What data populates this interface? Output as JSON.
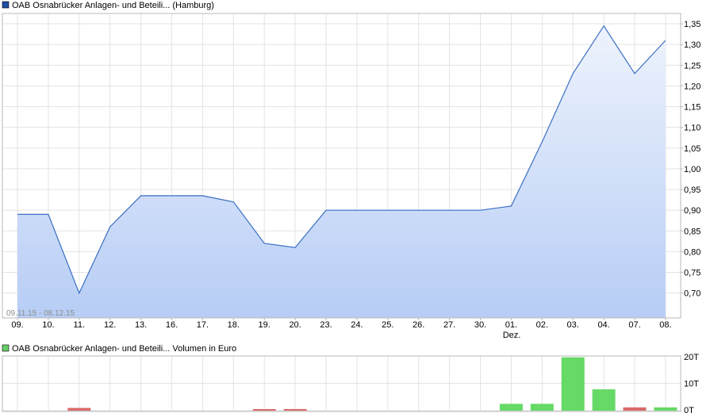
{
  "price_chart": {
    "legend_label": "OAB Osnabrücker Anlagen- und Beteili... (Hamburg)",
    "legend_color": "#1f4fa3",
    "date_range": "09.11.15 - 08.12.15",
    "month_label": "Dez.",
    "line_color": "#3a6fc2",
    "fill_top": "#eef3fd",
    "fill_bottom": "#b7cdf5"
  },
  "volume_chart": {
    "legend_label": "OAB Osnabrücker Anlagen- und Beteili... Volumen in Euro",
    "legend_color": "#66cc66",
    "up_color": "#66d966",
    "down_color": "#d96a6a"
  },
  "chart_data": [
    {
      "type": "line",
      "categories": [
        "09.",
        "10.",
        "11.",
        "12.",
        "13.",
        "16.",
        "17.",
        "18.",
        "19.",
        "20.",
        "23.",
        "24.",
        "25.",
        "26.",
        "27.",
        "30.",
        "01.",
        "02.",
        "03.",
        "04.",
        "07.",
        "08."
      ],
      "series": [
        {
          "name": "OAB Osnabrücker Anlagen- und Beteili... (Hamburg)",
          "values": [
            0.89,
            0.89,
            0.7,
            0.86,
            0.935,
            0.935,
            0.935,
            0.92,
            0.82,
            0.81,
            0.9,
            0.9,
            0.9,
            0.9,
            0.9,
            0.9,
            0.91,
            1.065,
            1.23,
            1.345,
            1.23,
            1.31
          ]
        }
      ],
      "yticks": [
        "1,35",
        "1,30",
        "1,25",
        "1,20",
        "1,15",
        "1,10",
        "1,05",
        "1,00",
        "0,95",
        "0,90",
        "0,85",
        "0,80",
        "0,75",
        "0,70"
      ],
      "ylim": [
        0.64,
        1.375
      ],
      "grid": true
    },
    {
      "type": "bar",
      "categories": [
        "09.",
        "10.",
        "11.",
        "12.",
        "13.",
        "16.",
        "17.",
        "18.",
        "19.",
        "20.",
        "23.",
        "24.",
        "25.",
        "26.",
        "27.",
        "30.",
        "01.",
        "02.",
        "03.",
        "04.",
        "07.",
        "08."
      ],
      "series": [
        {
          "name": "OAB Osnabrücker Anlagen- und Beteili... Volumen in Euro",
          "values": [
            0,
            0,
            1000,
            0,
            0,
            0,
            0,
            0,
            400,
            600,
            0,
            0,
            0,
            0,
            0,
            0,
            2500,
            2500,
            19500,
            7800,
            1200,
            1200
          ],
          "direction": [
            "none",
            "none",
            "down",
            "none",
            "none",
            "none",
            "none",
            "none",
            "down",
            "down",
            "none",
            "none",
            "none",
            "none",
            "none",
            "none",
            "up",
            "up",
            "up",
            "up",
            "down",
            "up"
          ]
        }
      ],
      "yticks": [
        "20T",
        "10T",
        "0T"
      ],
      "ylim": [
        0,
        20000
      ],
      "grid": true
    }
  ]
}
